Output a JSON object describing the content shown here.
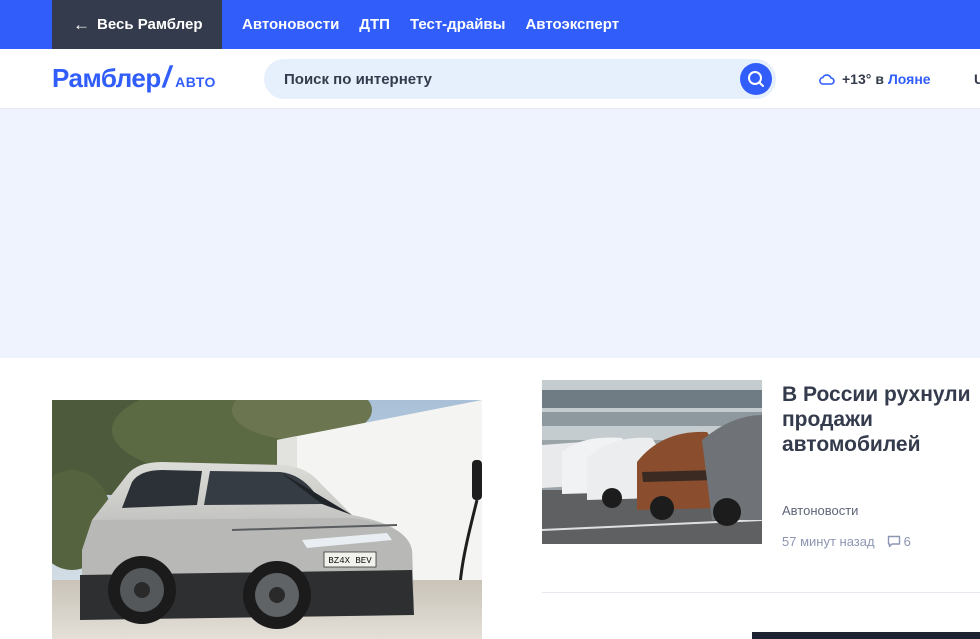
{
  "topbar": {
    "back_label": "Весь Рамблер",
    "nav": [
      "Автоновости",
      "ДТП",
      "Тест-драйвы",
      "Автоэксперт"
    ]
  },
  "header": {
    "logo_main": "Рамблер",
    "logo_slash": "/",
    "logo_sub": "АВТО",
    "search_placeholder": "Поиск по интернету",
    "weather": {
      "icon": "cloud-icon",
      "temp": "+13°",
      "in": "в",
      "city": "Лояне"
    },
    "cut_text": "U"
  },
  "content": {
    "main_image_alt": "",
    "side_article": {
      "title": "В России рухнули продажи автомобилей",
      "category": "Автоновости",
      "time": "57 минут назад",
      "comments": "6"
    }
  },
  "colors": {
    "brand_blue": "#315efb",
    "dark_button": "#343b4c",
    "ad_bg": "#eef3fd",
    "text_dark": "#343b4c",
    "text_muted": "#8d96b2"
  }
}
